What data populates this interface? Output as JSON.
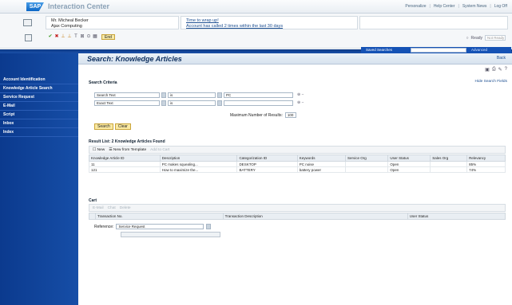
{
  "header": {
    "logo": "SAP",
    "app_title": "Interaction Center",
    "links": [
      "Personalize",
      "Help Center",
      "System News",
      "Log Off"
    ]
  },
  "context": {
    "customer_name": "Mr. Micheal Becker",
    "company": "Ajax Computing",
    "alert_1": "Time to wrap up!",
    "alert_2": "Account has called 2 times within the last 30 days",
    "end_button": "End",
    "status_label": "Ready",
    "status_value": "Not Ready"
  },
  "saved_searches": {
    "label": "Saved Searches",
    "advanced": "Advanced"
  },
  "sidebar": {
    "items": [
      {
        "label": "Account Identification"
      },
      {
        "label": "Knowledge Article Search"
      },
      {
        "label": "Service Request"
      },
      {
        "label": "E-Mail"
      },
      {
        "label": "Script"
      },
      {
        "label": "Inbox"
      },
      {
        "label": "Index"
      }
    ]
  },
  "page": {
    "title": "Search: Knowledge Articles",
    "back": "Back",
    "search_criteria": "Search Criteria",
    "hide_fields": "Hide Search Fields"
  },
  "criteria": {
    "rows": [
      {
        "field": "Search Text",
        "operator": "is",
        "value": "PC"
      },
      {
        "field": "Exact Text",
        "operator": "is",
        "value": ""
      }
    ],
    "max_label": "Maximum Number of Results:",
    "max_value": "100",
    "search_btn": "Search",
    "clear_btn": "Clear"
  },
  "result": {
    "header": "Result List: 2 Knowledge Articles Found",
    "toolbar": {
      "new": "New",
      "new_template": "New from Template",
      "add_cart": "Add to Cart"
    },
    "columns": [
      "Knowledge Article ID",
      "Description",
      "Categorization ID",
      "Keywords",
      "Service Org",
      "User Status",
      "Sales Org",
      "Relevancy"
    ],
    "rows": [
      [
        "11",
        "PC makes squealing...",
        "DESKTOP",
        "PC noise",
        "",
        "Open",
        "",
        "85%"
      ],
      [
        "121",
        "How to maximize the...",
        "BATTERY",
        "battery power",
        "",
        "Open",
        "",
        "74%"
      ]
    ]
  },
  "cart": {
    "header": "Cart",
    "toolbar": [
      "E-Mail",
      "Chat",
      "Delete"
    ],
    "columns": [
      "Transaction No.",
      "Transaction Description",
      "User Status"
    ],
    "reference_label": "Reference:",
    "reference_value": "Service Request"
  }
}
